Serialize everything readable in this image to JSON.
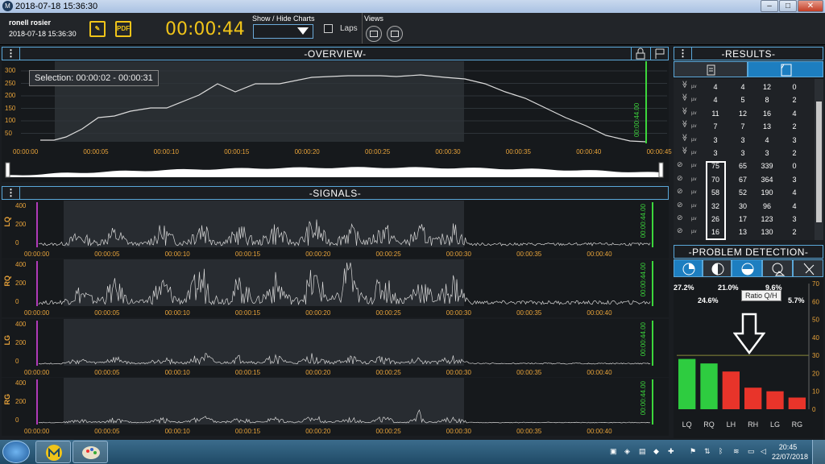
{
  "window": {
    "title": "2018-07-18 15:36:30",
    "app_icon": "M"
  },
  "toolbar": {
    "user_name": "ronell rosier",
    "user_date": "2018-07-18 15:36:30",
    "notes_icon": "notes-icon",
    "pdf_label": "PDF",
    "timer": "00:00:44",
    "show_hide_label": "Show / Hide Charts",
    "laps_label": "Laps",
    "views_label": "Views"
  },
  "overview": {
    "title": "-OVERVIEW-",
    "selection_label": "Selection: 00:00:02 - 00:00:31",
    "marker_label": "00:00:44.00",
    "y_ticks": [
      "300",
      "250",
      "200",
      "150",
      "100",
      "50"
    ],
    "x_ticks": [
      "00:00:00",
      "00:00:05",
      "00:00:10",
      "00:00:15",
      "00:00:20",
      "00:00:25",
      "00:00:30",
      "00:00:35",
      "00:00:40",
      "00:00:45"
    ]
  },
  "signals": {
    "title": "-SIGNALS-",
    "marker_label": "00:00:44.00",
    "x_ticks": [
      "00:00:00",
      "00:00:05",
      "00:00:10",
      "00:00:15",
      "00:00:20",
      "00:00:25",
      "00:00:30",
      "00:00:35",
      "00:00:40"
    ],
    "channels": [
      {
        "name": "LQ",
        "y_ticks": [
          "400",
          "200",
          "0"
        ]
      },
      {
        "name": "RQ",
        "y_ticks": [
          "400",
          "200",
          "0"
        ]
      },
      {
        "name": "LG",
        "y_ticks": [
          "400",
          "200",
          "0"
        ]
      },
      {
        "name": "RG",
        "y_ticks": [
          "400",
          "200",
          "0"
        ]
      }
    ]
  },
  "results": {
    "title": "-RESULTS-",
    "unit": "µv",
    "rows": [
      [
        "4",
        "4",
        "12",
        "0"
      ],
      [
        "4",
        "5",
        "8",
        "2"
      ],
      [
        "11",
        "12",
        "16",
        "4"
      ],
      [
        "7",
        "7",
        "13",
        "2"
      ],
      [
        "3",
        "3",
        "4",
        "3"
      ],
      [
        "3",
        "3",
        "3",
        "2"
      ],
      [
        "75",
        "65",
        "339",
        "0"
      ],
      [
        "70",
        "67",
        "364",
        "3"
      ],
      [
        "58",
        "52",
        "190",
        "4"
      ],
      [
        "32",
        "30",
        "96",
        "4"
      ],
      [
        "26",
        "17",
        "123",
        "3"
      ],
      [
        "16",
        "13",
        "130",
        "2"
      ]
    ]
  },
  "problem": {
    "title": "-PROBLEM DETECTION-",
    "tooltip": "Ratio Q/H",
    "percent_top": [
      "27.2%",
      "21.0%",
      "9.6%"
    ],
    "percent_bottom": [
      "24.6%",
      "5.7%"
    ]
  },
  "chart_data": {
    "type": "bar",
    "categories": [
      "LQ",
      "RQ",
      "LH",
      "RH",
      "LG",
      "RG"
    ],
    "values": [
      28,
      25.5,
      21,
      12,
      10,
      6.5
    ],
    "colors": [
      "#2ecc40",
      "#2ecc40",
      "#e8342a",
      "#e8342a",
      "#e8342a",
      "#e8342a"
    ],
    "ylim": [
      0,
      70
    ],
    "y_ticks": [
      "70",
      "60",
      "50",
      "40",
      "30",
      "20",
      "10",
      "0"
    ]
  },
  "taskbar": {
    "time": "20:45",
    "date": "22/07/2018"
  }
}
